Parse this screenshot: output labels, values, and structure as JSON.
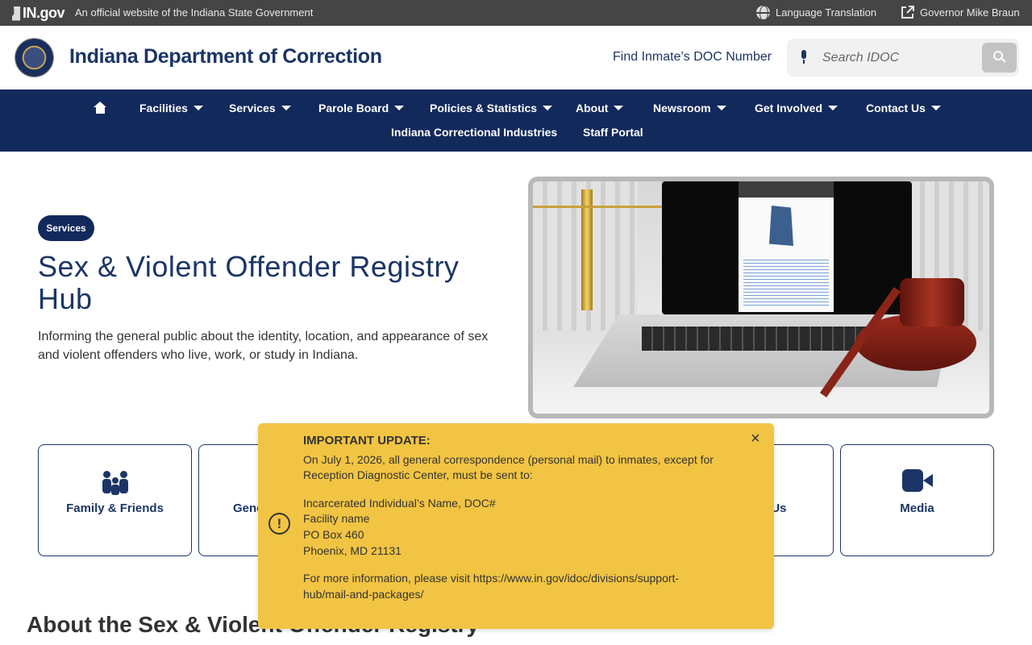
{
  "govbar": {
    "logo": "IN.gov",
    "tagline": "An official website of the Indiana State Government",
    "language": "Language Translation",
    "governor": "Governor Mike Braun"
  },
  "header": {
    "site_title": "Indiana Department of Correction",
    "find_inmate": "Find Inmate’s DOC Number",
    "search_placeholder": "Search IDOC"
  },
  "nav": {
    "items": [
      {
        "label": "Facilities"
      },
      {
        "label": "Services"
      },
      {
        "label": "Parole Board"
      },
      {
        "label": "Policies & Statistics"
      },
      {
        "label": "About"
      },
      {
        "label": "Newsroom"
      },
      {
        "label": "Get Involved"
      },
      {
        "label": "Contact Us"
      }
    ],
    "row2": [
      {
        "label": "Indiana Correctional Industries"
      },
      {
        "label": "Staff Portal"
      }
    ]
  },
  "hero": {
    "badge": "Services",
    "title": "Sex & Violent Offender Registry Hub",
    "description": "Informing the general public about the identity, location, and appearance of sex and violent offenders who live, work, or study in Indiana."
  },
  "cards": [
    {
      "label": "Family & Friends",
      "icon": "family-icon"
    },
    {
      "label": "Gene",
      "icon": ""
    },
    {
      "label": "n Us",
      "icon": ""
    },
    {
      "label": "Media",
      "icon": "video-camera-icon"
    }
  ],
  "about_heading": "About the Sex & Violent Offender Registry",
  "alert": {
    "heading": "IMPORTANT UPDATE:",
    "body": "On July 1, 2026, all general correspondence (personal mail) to inmates, except for Reception Diagnostic Center, must be sent to:",
    "address": [
      "Incarcerated Individual’s Name, DOC#",
      "Facility name",
      "PO Box 460",
      "Phoenix, MD 21131"
    ],
    "more_info": "For more information, please visit https://www.in.gov/idoc/divisions/support-hub/mail-and-packages/",
    "close": "×",
    "icon": "!"
  },
  "colors": {
    "navy": "#12295c",
    "title_blue": "#1b3566",
    "alert_yellow": "#f2c443",
    "govbar": "#454545"
  }
}
